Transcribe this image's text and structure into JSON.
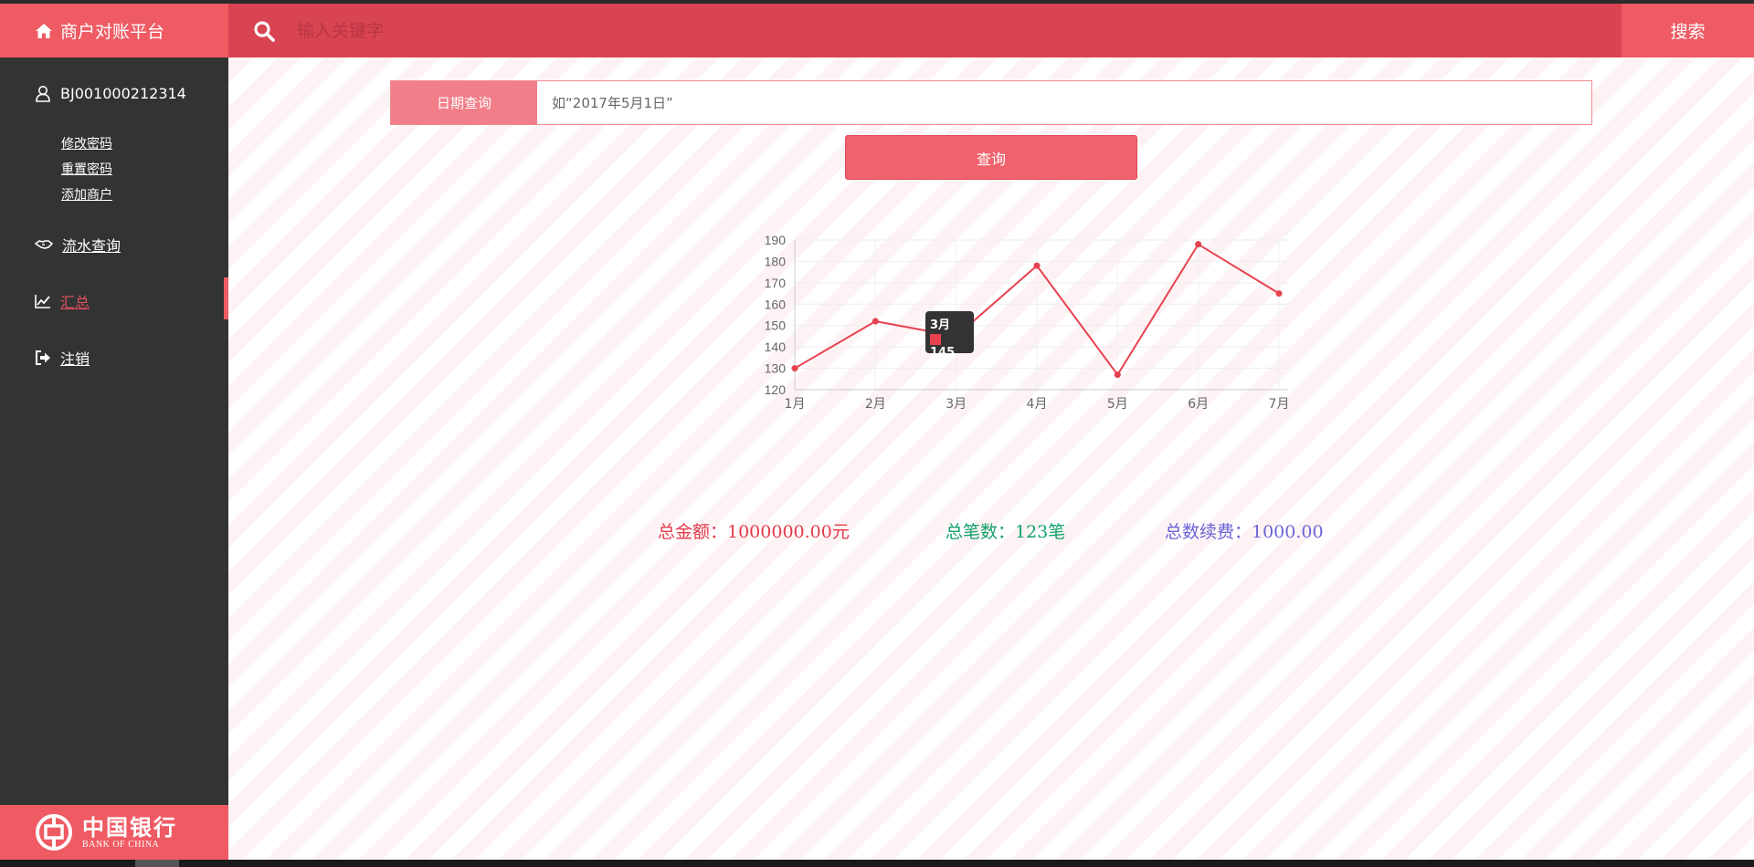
{
  "header": {
    "brand_title": "商户对账平台",
    "search_placeholder": "输入关键字",
    "search_button": "搜索"
  },
  "sidebar": {
    "user_id": "BJ001000212314",
    "sub_links": [
      "修改密码",
      "重置密码",
      "添加商户"
    ],
    "nav": [
      {
        "label": "流水查询",
        "icon": "handshake-icon"
      },
      {
        "label": "汇总",
        "icon": "line-chart-icon",
        "active": true
      },
      {
        "label": "注销",
        "icon": "sign-out-icon"
      }
    ],
    "bank_cn": "中国银行",
    "bank_en": "BANK OF CHINA"
  },
  "query": {
    "date_label": "日期查询",
    "date_placeholder": "如“2017年5月1日”",
    "query_button": "查询"
  },
  "chart_data": {
    "type": "line",
    "categories": [
      "1月",
      "2月",
      "3月",
      "4月",
      "5月",
      "6月",
      "7月"
    ],
    "values": [
      130,
      152,
      145,
      178,
      127,
      188,
      165
    ],
    "ylim": [
      120,
      190
    ],
    "yticks": [
      120,
      130,
      140,
      150,
      160,
      170,
      180,
      190
    ],
    "grid": true,
    "color": "#e8414f",
    "tooltip": {
      "title": "3月",
      "value": "145"
    }
  },
  "summary": {
    "total_amount": "总金额：1000000.00元",
    "total_count": "总笔数：123笔",
    "total_fee": "总数续费：1000.00"
  },
  "colors": {
    "accent": "#ef5b63",
    "header": "#d94452",
    "sidebar": "#333333"
  }
}
